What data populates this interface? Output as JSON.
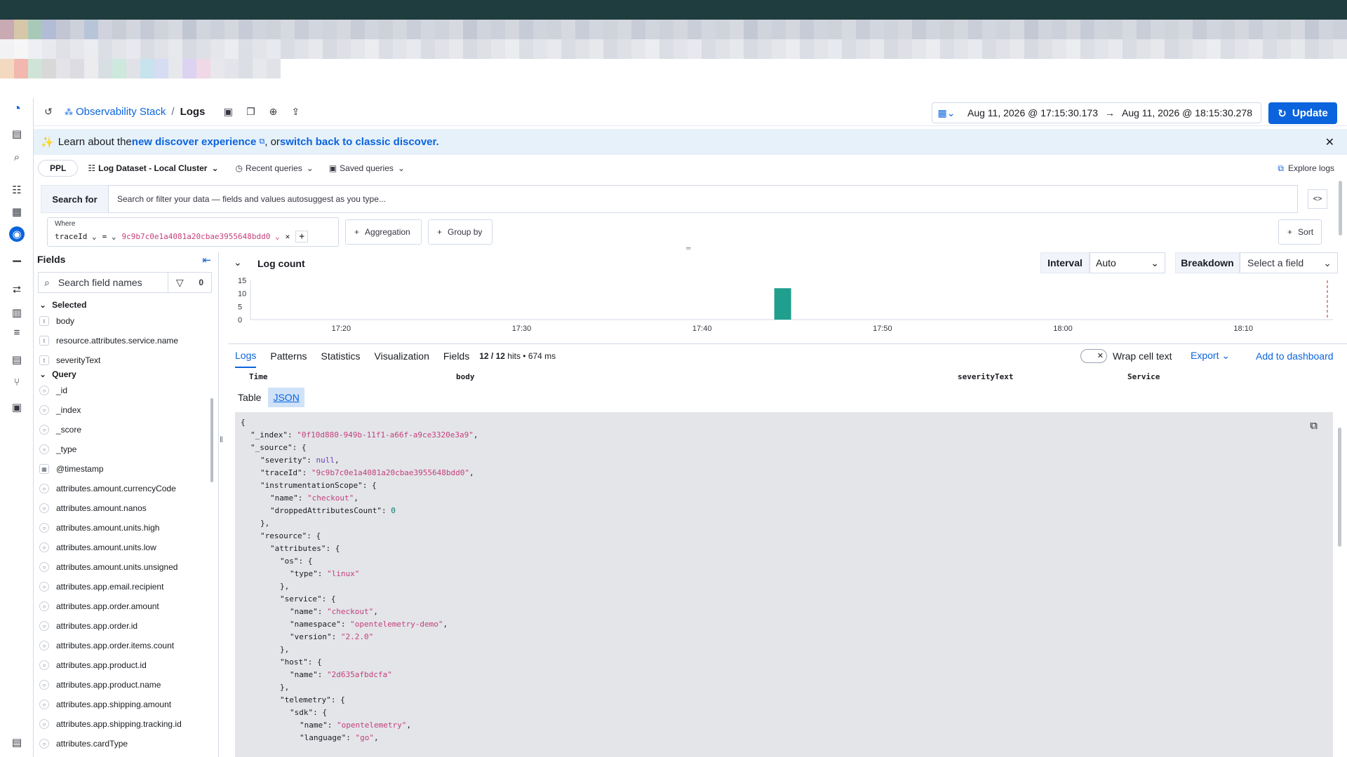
{
  "pixel_rows": [
    [
      "#1f3d3f",
      "#1f3d3f",
      "#1f3d3f",
      "#1f3d3f",
      "#1f3d3f",
      "#1f3d3f",
      "#1f3d3f",
      "#1f3d3f",
      "#1f3d3f",
      "#1f3d3f",
      "#1f3d3f",
      "#1f3d3f",
      "#1f3d3f",
      "#1f3d3f",
      "#1f3d3f",
      "#1f3d3f",
      "#1f3d3f",
      "#1f3d3f",
      "#1f3d3f",
      "#1f3d3f",
      "#1f3d3f",
      "#1f3d3f",
      "#1f3d3f",
      "#1f3d3f",
      "#1f3d3f",
      "#1f3d3f",
      "#1f3d3f",
      "#1f3d3f",
      "#1f3d3f",
      "#1f3d3f",
      "#1f3d3f",
      "#1f3d3f",
      "#1f3d3f",
      "#1f3d3f",
      "#1f3d3f",
      "#1f3d3f",
      "#1f3d3f",
      "#1f3d3f",
      "#1f3d3f",
      "#1f3d3f",
      "#1f3d3f",
      "#1f3d3f",
      "#1f3d3f",
      "#1f3d3f",
      "#1f3d3f",
      "#1f3d3f",
      "#1f3d3f",
      "#1f3d3f",
      "#1f3d3f",
      "#1f3d3f",
      "#1f3d3f",
      "#1f3d3f",
      "#1f3d3f",
      "#1f3d3f",
      "#1f3d3f",
      "#1f3d3f",
      "#1f3d3f",
      "#1f3d3f",
      "#1f3d3f",
      "#1f3d3f",
      "#1f3d3f",
      "#1f3d3f",
      "#1f3d3f",
      "#1f3d3f",
      "#1f3d3f",
      "#1f3d3f",
      "#1f3d3f",
      "#1f3d3f",
      "#1f3d3f",
      "#1f3d3f",
      "#1f3d3f",
      "#1f3d3f",
      "#1f3d3f",
      "#1f3d3f",
      "#1f3d3f",
      "#1f3d3f",
      "#1f3d3f",
      "#1f3d3f",
      "#1f3d3f",
      "#1f3d3f",
      "#1f3d3f",
      "#1f3d3f",
      "#1f3d3f",
      "#1f3d3f",
      "#1f3d3f",
      "#1f3d3f",
      "#1f3d3f",
      "#1f3d3f",
      "#1f3d3f",
      "#1f3d3f",
      "#1f3d3f",
      "#1f3d3f",
      "#1f3d3f",
      "#1f3d3f",
      "#1f3d3f",
      "#1f3d3f"
    ],
    [
      "#c9a9b2",
      "#d6c7a9",
      "#a9c9b8",
      "#b2bcd6",
      "#c2c5d4",
      "#cdd1d9",
      "#b8c5d9",
      "#d0d3de",
      "#c9cdd6",
      "#d3d6de",
      "#c5cbd6",
      "#cfd3dc",
      "#d6d9e0",
      "#c1c7d2",
      "#d1d5dd",
      "#cbd0da",
      "#d4d7de",
      "#c6ccd7",
      "#d0d4dc",
      "#cdd2db",
      "#d6d9e0",
      "#c8cdd8",
      "#d2d6de",
      "#cfd3dc",
      "#d5d8df",
      "#c7ccd7",
      "#d1d5dd",
      "#cdd1da",
      "#d4d7de",
      "#c9ced8",
      "#d2d6de",
      "#cfd3dc",
      "#d6d9e0",
      "#c3c9d4",
      "#d0d4dc",
      "#cbd0da",
      "#d4d7de",
      "#c6ccd7",
      "#d0d4dc",
      "#cdd2db",
      "#d6d9e0",
      "#c8cdd8",
      "#d2d6de",
      "#cfd3dc",
      "#d5d8df",
      "#c7ccd7",
      "#d1d5dd",
      "#cdd1da",
      "#d4d7de",
      "#c9ced8",
      "#d2d6de",
      "#cfd3dc",
      "#d6d9e0",
      "#c3c9d4",
      "#d0d4dc",
      "#cbd0da",
      "#d4d7de",
      "#c6ccd7",
      "#d0d4dc",
      "#cdd2db",
      "#d6d9e0",
      "#c8cdd8",
      "#d2d6de",
      "#cfd3dc",
      "#d5d8df",
      "#c7ccd7",
      "#d1d5dd",
      "#cdd1da",
      "#d4d7de",
      "#c9ced8",
      "#d2d6de",
      "#cfd3dc",
      "#d6d9e0",
      "#c3c9d4",
      "#d0d4dc",
      "#cbd0da",
      "#d4d7de",
      "#c6ccd7",
      "#d0d4dc",
      "#cdd2db",
      "#d6d9e0",
      "#c8cdd8",
      "#d2d6de",
      "#cfd3dc",
      "#d5d8df",
      "#c7ccd7",
      "#d1d5dd",
      "#cdd1da",
      "#d4d7de",
      "#c9ced8",
      "#d2d6de",
      "#cfd3dc",
      "#d6d9e0",
      "#c3c9d4",
      "#d0d4dc",
      "#cbd0da"
    ],
    [
      "#f2f2f4",
      "#f6f6f7",
      "#eeeff2",
      "#e8e9ee",
      "#dfe1e7",
      "#e5e7ec",
      "#ebecf0",
      "#dcdee5",
      "#e2e4ea",
      "#e8e9ee",
      "#dadce3",
      "#e0e2e8",
      "#e6e8ec",
      "#d8dae2",
      "#dee0e6",
      "#e4e6eb",
      "#ebecf0",
      "#dcdee5",
      "#e2e4ea",
      "#e8e9ee",
      "#dadce3",
      "#e0e2e8",
      "#e6e8ec",
      "#d8dae2",
      "#dee0e6",
      "#e4e6eb",
      "#ebecf0",
      "#dcdee5",
      "#e2e4ea",
      "#e8e9ee",
      "#dadce3",
      "#e0e2e8",
      "#e6e8ec",
      "#d8dae2",
      "#dee0e6",
      "#e4e6eb",
      "#ebecf0",
      "#dcdee5",
      "#e2e4ea",
      "#e8e9ee",
      "#dadce3",
      "#e0e2e8",
      "#e6e8ec",
      "#d8dae2",
      "#dee0e6",
      "#e4e6eb",
      "#ebecf0",
      "#dcdee5",
      "#e2e4ea",
      "#e8e9ee",
      "#dadce3",
      "#e0e2e8",
      "#e6e8ec",
      "#d8dae2",
      "#dee0e6",
      "#e4e6eb",
      "#ebecf0",
      "#dcdee5",
      "#e2e4ea",
      "#e8e9ee",
      "#dadce3",
      "#e0e2e8",
      "#e6e8ec",
      "#d8dae2",
      "#dee0e6",
      "#e4e6eb",
      "#ebecf0",
      "#dcdee5",
      "#e2e4ea",
      "#e8e9ee",
      "#dadce3",
      "#e0e2e8",
      "#e6e8ec",
      "#d8dae2",
      "#dee0e6",
      "#e4e6eb",
      "#ebecf0",
      "#dcdee5",
      "#e2e4ea",
      "#e8e9ee",
      "#dadce3",
      "#e0e2e8",
      "#e6e8ec",
      "#d8dae2",
      "#dee0e6",
      "#e4e6eb",
      "#ebecf0",
      "#dcdee5",
      "#e2e4ea",
      "#e8e9ee",
      "#dadce3",
      "#e0e2e8",
      "#e6e8ec",
      "#d8dae2",
      "#dee0e6",
      "#e4e6eb"
    ],
    [
      "#f3d9c0",
      "#f2b8b0",
      "#cfe4d6",
      "#d8d8d8",
      "#e4e4e8",
      "#dcdce2",
      "#ececef",
      "#d8dfe3",
      "#cde8dc",
      "#e0e2e8",
      "#c6e3ee",
      "#d6dcf2",
      "#e6e8ec",
      "#dcd2f2",
      "#f0d8e6",
      "#e8e8ec",
      "#e2e4ea",
      "#dcdee5",
      "#e6e8ec",
      "#e0e2e8",
      "#ffffff",
      "#ffffff",
      "#ffffff",
      "#ffffff",
      "#ffffff",
      "#ffffff",
      "#ffffff",
      "#ffffff",
      "#ffffff",
      "#ffffff",
      "#ffffff",
      "#ffffff",
      "#ffffff",
      "#ffffff",
      "#ffffff",
      "#ffffff",
      "#ffffff",
      "#ffffff",
      "#ffffff",
      "#ffffff",
      "#ffffff",
      "#ffffff",
      "#ffffff",
      "#ffffff",
      "#ffffff",
      "#ffffff",
      "#ffffff",
      "#ffffff",
      "#ffffff",
      "#ffffff",
      "#ffffff",
      "#ffffff",
      "#ffffff",
      "#ffffff",
      "#ffffff",
      "#ffffff",
      "#ffffff",
      "#ffffff",
      "#ffffff",
      "#ffffff",
      "#ffffff",
      "#ffffff",
      "#ffffff",
      "#ffffff",
      "#ffffff",
      "#ffffff",
      "#ffffff",
      "#ffffff",
      "#ffffff",
      "#ffffff",
      "#ffffff",
      "#ffffff",
      "#ffffff",
      "#ffffff",
      "#ffffff",
      "#ffffff",
      "#ffffff",
      "#ffffff",
      "#ffffff",
      "#ffffff",
      "#ffffff",
      "#ffffff",
      "#ffffff",
      "#ffffff",
      "#ffffff",
      "#ffffff",
      "#ffffff",
      "#ffffff",
      "#ffffff",
      "#ffffff",
      "#ffffff",
      "#ffffff",
      "#ffffff",
      "#ffffff",
      "#ffffff",
      "#ffffff"
    ]
  ],
  "header": {
    "breadcrumb_app": "Observability Stack",
    "breadcrumb_sep": "/",
    "breadcrumb_page": "Logs",
    "date_start": "Aug 11, 2026 @ 17:15:30.173",
    "date_arrow": "→",
    "date_end": "Aug 11, 2026 @ 18:15:30.278",
    "update_label": "Update"
  },
  "banner": {
    "prefix": "Learn about the ",
    "link1": "new discover experience",
    "mid": ", or ",
    "link2": "switch back to classic discover."
  },
  "query_bar": {
    "lang": "PPL",
    "dataset": "Log Dataset - Local Cluster",
    "recent": "Recent queries",
    "saved": "Saved queries",
    "explore": "Explore logs"
  },
  "search": {
    "label": "Search for",
    "placeholder": "Search or filter your data — fields and values autosuggest as you type..."
  },
  "where": {
    "label": "Where",
    "field": "traceId",
    "op": "=",
    "value": "9c9b7c0e1a4081a20cbae3955648bdd0",
    "aggregation": "Aggregation",
    "group_by": "Group by",
    "sort": "Sort"
  },
  "fields_panel": {
    "title": "Fields",
    "search_placeholder": "Search field names",
    "filter_count": "0",
    "selected_label": "Selected",
    "selected": [
      {
        "type": "t",
        "name": "body"
      },
      {
        "type": "t",
        "name": "resource.attributes.service.name"
      },
      {
        "type": "t",
        "name": "severityText"
      }
    ],
    "query_label": "Query",
    "query": [
      {
        "type": "r",
        "name": "_id"
      },
      {
        "type": "r",
        "name": "_index"
      },
      {
        "type": "r",
        "name": "_score"
      },
      {
        "type": "r",
        "name": "_type"
      },
      {
        "type": "d",
        "name": "@timestamp"
      },
      {
        "type": "r",
        "name": "attributes.amount.currencyCode"
      },
      {
        "type": "r",
        "name": "attributes.amount.nanos"
      },
      {
        "type": "r",
        "name": "attributes.amount.units.high"
      },
      {
        "type": "r",
        "name": "attributes.amount.units.low"
      },
      {
        "type": "r",
        "name": "attributes.amount.units.unsigned"
      },
      {
        "type": "r",
        "name": "attributes.app.email.recipient"
      },
      {
        "type": "r",
        "name": "attributes.app.order.amount"
      },
      {
        "type": "r",
        "name": "attributes.app.order.id"
      },
      {
        "type": "r",
        "name": "attributes.app.order.items.count"
      },
      {
        "type": "r",
        "name": "attributes.app.product.id"
      },
      {
        "type": "r",
        "name": "attributes.app.product.name"
      },
      {
        "type": "r",
        "name": "attributes.app.shipping.amount"
      },
      {
        "type": "r",
        "name": "attributes.app.shipping.tracking.id"
      },
      {
        "type": "r",
        "name": "attributes.cardType"
      }
    ]
  },
  "log_count": {
    "title": "Log count",
    "interval_label": "Interval",
    "interval_value": "Auto",
    "breakdown_label": "Breakdown",
    "breakdown_value": "Select a field"
  },
  "chart_data": {
    "type": "bar",
    "title": "Log count",
    "x_ticks": [
      "17:20",
      "17:30",
      "17:40",
      "17:50",
      "18:00",
      "18:10"
    ],
    "x_range_min": [
      "17:15",
      "18:15"
    ],
    "y_ticks": [
      0,
      5,
      10,
      15
    ],
    "ylim": [
      0,
      15
    ],
    "bars": [
      {
        "x_minutes": 44.5,
        "value": 12
      }
    ],
    "bar_color": "#209f8e",
    "grid": false
  },
  "tabs": {
    "items": [
      "Logs",
      "Patterns",
      "Statistics",
      "Visualization",
      "Fields"
    ],
    "hits": "12 / 12",
    "hits_suffix": "hits • 674 ms",
    "wrap": "Wrap cell text",
    "export": "Export",
    "add_dashboard": "Add to dashboard"
  },
  "columns": [
    "Time",
    "body",
    "severityText",
    "Service"
  ],
  "json_tabs": [
    "Table",
    "JSON"
  ],
  "json_lines": [
    [
      0,
      "{",
      "",
      ""
    ],
    [
      1,
      "\"_index\": ",
      "\"0f10d880-949b-11f1-a66f-a9ce3320e3a9\"",
      ","
    ],
    [
      1,
      "\"_source\": {",
      "",
      ""
    ],
    [
      2,
      "\"severity\": ",
      "null",
      ","
    ],
    [
      2,
      "\"traceId\": ",
      "\"9c9b7c0e1a4081a20cbae3955648bdd0\"",
      ","
    ],
    [
      2,
      "\"instrumentationScope\": {",
      "",
      ""
    ],
    [
      3,
      "\"name\": ",
      "\"checkout\"",
      ","
    ],
    [
      3,
      "\"droppedAttributesCount\": ",
      "0",
      ""
    ],
    [
      2,
      "},",
      "",
      ""
    ],
    [
      2,
      "\"resource\": {",
      "",
      ""
    ],
    [
      3,
      "\"attributes\": {",
      "",
      ""
    ],
    [
      4,
      "\"os\": {",
      "",
      ""
    ],
    [
      5,
      "\"type\": ",
      "\"linux\"",
      ""
    ],
    [
      4,
      "},",
      "",
      ""
    ],
    [
      4,
      "\"service\": {",
      "",
      ""
    ],
    [
      5,
      "\"name\": ",
      "\"checkout\"",
      ","
    ],
    [
      5,
      "\"namespace\": ",
      "\"opentelemetry-demo\"",
      ","
    ],
    [
      5,
      "\"version\": ",
      "\"2.2.0\"",
      ""
    ],
    [
      4,
      "},",
      "",
      ""
    ],
    [
      4,
      "\"host\": {",
      "",
      ""
    ],
    [
      5,
      "\"name\": ",
      "\"2d635afbdcfa\"",
      ""
    ],
    [
      4,
      "},",
      "",
      ""
    ],
    [
      4,
      "\"telemetry\": {",
      "",
      ""
    ],
    [
      5,
      "\"sdk\": {",
      "",
      ""
    ],
    [
      6,
      "\"name\": ",
      "\"opentelemetry\"",
      ","
    ],
    [
      6,
      "\"language\": ",
      "\"go\"",
      ","
    ]
  ]
}
